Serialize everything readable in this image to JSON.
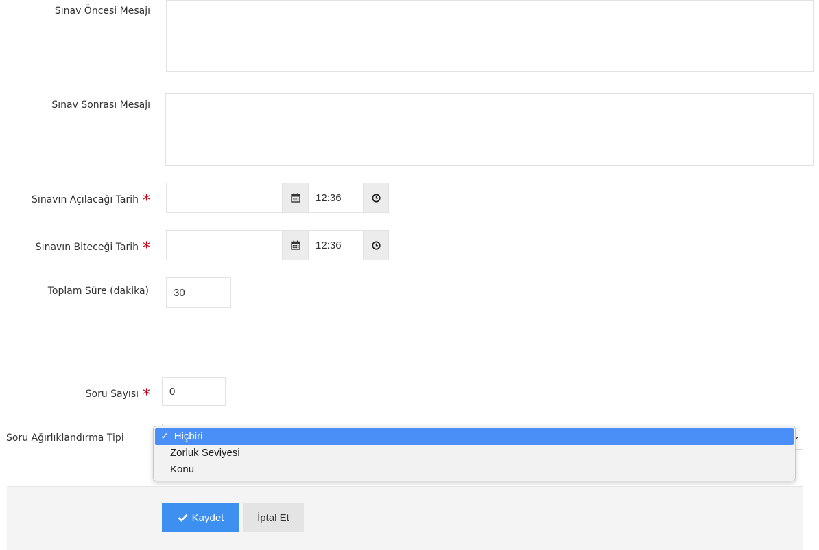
{
  "form": {
    "pre_exam_message": {
      "label": "Sınav Öncesi Mesajı",
      "value": ""
    },
    "post_exam_message": {
      "label": "Sınav Sonrası Mesajı",
      "value": ""
    },
    "open_date": {
      "label": "Sınavın Açılacağı Tarih",
      "required_mark": "*",
      "date_value": "",
      "time_value": "12:36"
    },
    "end_date": {
      "label": "Sınavın Biteceği Tarih",
      "required_mark": "*",
      "date_value": "",
      "time_value": "12:36"
    },
    "total_time": {
      "label": "Toplam Süre (dakika)",
      "value": "30"
    },
    "question_count": {
      "label": "Soru Sayısı",
      "required_mark": "*",
      "value": "0"
    },
    "weighting_type": {
      "label": "Soru Ağırlıklandırma Tipi",
      "check_mark": "✓",
      "options": [
        "Hiçbiri",
        "Zorluk Seviyesi",
        "Konu"
      ],
      "selected": "Hiçbiri"
    }
  },
  "actions": {
    "save_label": "Kaydet",
    "cancel_label": "İptal Et"
  },
  "icons": {
    "calendar": "calendar-icon",
    "clock": "clock-icon",
    "check": "check-icon",
    "select_arrow": "chevron-down-icon"
  },
  "colors": {
    "primary": "#3d8ff0",
    "required": "#d0021b",
    "selected_option": "#4a8ff7"
  }
}
